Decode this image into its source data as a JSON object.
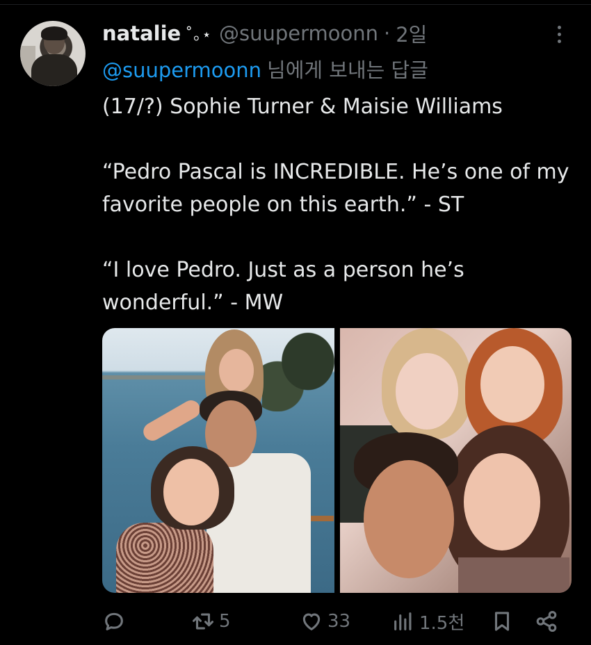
{
  "tweet": {
    "author": {
      "display_name": "natalie",
      "name_decoration": "˚｡⋆",
      "handle": "@suupermoonn",
      "separator": "·",
      "time_ago": "2일"
    },
    "reply_context": {
      "mention": "@suupermoonn",
      "suffix": "님에게 보내는 답글"
    },
    "text": {
      "line1": "(17/?) Sophie Turner & Maisie Williams",
      "para2": "“Pedro Pascal is INCREDIBLE. He’s one of my favorite people on this earth.” - ST",
      "para3": "“I love Pedro. Just as a person he’s wonderful.” - MW"
    },
    "actions": {
      "reply_icon": "reply-icon",
      "retweet_icon": "retweet-icon",
      "retweet_count": "5",
      "like_icon": "heart-icon",
      "like_count": "33",
      "views_icon": "bar-chart-icon",
      "views_count": "1.5천",
      "bookmark_icon": "bookmark-icon",
      "share_icon": "share-icon"
    },
    "colors": {
      "background": "#000000",
      "text": "#e7e9ea",
      "muted": "#71767b",
      "link": "#1d9bf0"
    }
  }
}
